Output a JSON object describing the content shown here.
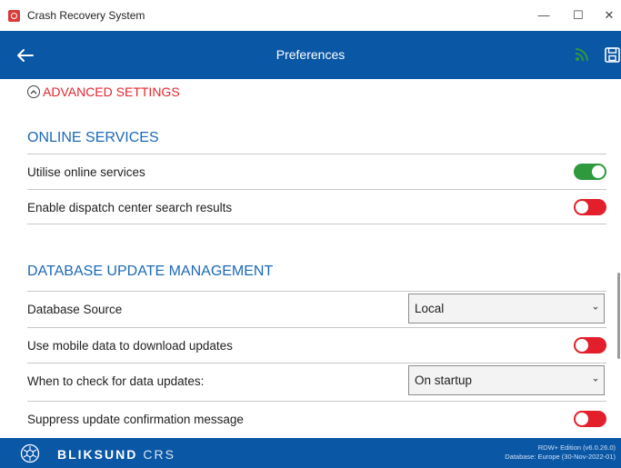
{
  "window": {
    "title": "Crash Recovery System",
    "minimize_glyph": "—",
    "maximize_glyph": "☐",
    "close_glyph": "✕"
  },
  "appbar": {
    "title": "Preferences",
    "back_icon": "arrow-left-icon",
    "feed_icon": "rss-feed-icon",
    "save_icon": "save-icon",
    "accent": "#0a57a6",
    "feed_color": "#2e9a3d"
  },
  "advanced": {
    "label": "ADVANCED SETTINGS",
    "color": "#e6252f"
  },
  "online_services": {
    "title": "ONLINE SERVICES",
    "rows": [
      {
        "label": "Utilise online services",
        "toggle": "on"
      },
      {
        "label": "Enable dispatch center search results",
        "toggle": "off"
      }
    ]
  },
  "db_update": {
    "title": "DATABASE UPDATE MANAGEMENT",
    "source_label": "Database Source",
    "source_value": "Local",
    "mobile_label": "Use mobile data to download updates",
    "mobile_toggle": "off",
    "check_label": "When to check for data updates:",
    "check_value": "On startup",
    "suppress_label": "Suppress update confirmation message",
    "suppress_toggle": "off"
  },
  "footer": {
    "brand": "BLIKSUND",
    "brand_sub": "CRS",
    "edition": "RDW+ Edition (v6.0.26.0)",
    "database": "Database: Europe (30-Nov-2022-01)"
  }
}
